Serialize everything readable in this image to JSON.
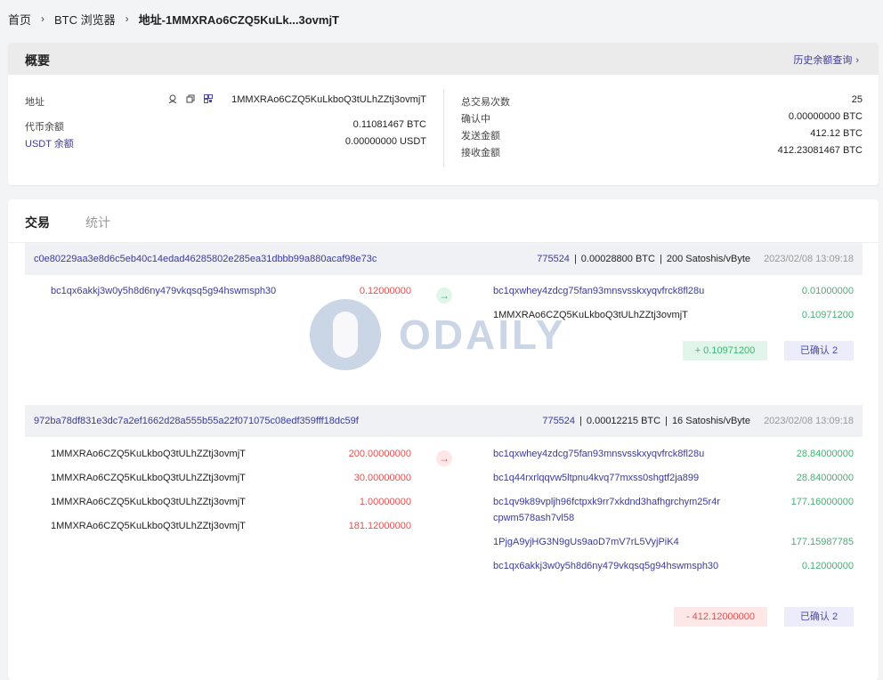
{
  "breadcrumb": {
    "home": "首页",
    "explorer": "BTC 浏览器",
    "current": "地址-1MMXRAo6CZQ5KuLk...3ovmjT"
  },
  "overview": {
    "title": "概要",
    "history_link": "历史余额查询",
    "address_label": "地址",
    "address_value": "1MMXRAo6CZQ5KuLkboQ3tULhZZtj3ovmjT",
    "token_balance_label": "代币余额",
    "token_balance_value": "0.11081467 BTC",
    "usdt_balance_label": "USDT 余额",
    "usdt_balance_value": "0.00000000 USDT",
    "total_tx_label": "总交易次数",
    "total_tx_value": "25",
    "confirming_label": "确认中",
    "confirming_value": "0.00000000 BTC",
    "sent_label": "发送金额",
    "sent_value": "412.12 BTC",
    "received_label": "接收金额",
    "received_value": "412.23081467 BTC"
  },
  "tabs": {
    "transactions": "交易",
    "stats": "统计"
  },
  "watermark": "ODAILY",
  "transactions": [
    {
      "hash": "c0e80229aa3e8d6c5eb40c14edad46285802e285ea31dbbb99a880acaf98e73c",
      "block": "775524",
      "fee": "0.00028800 BTC",
      "rate": "200 Satoshis/vByte",
      "time": "2023/02/08 13:09:18",
      "inputs": [
        {
          "address": "bc1qx6akkj3w0y5h8d6ny479vkqsq5g94hswmsph30",
          "amount": "0.12000000"
        }
      ],
      "outputs": [
        {
          "address": "bc1qxwhey4zdcg75fan93mnsvsskxyqvfrck8fl28u",
          "amount": "0.01000000"
        },
        {
          "address": "1MMXRAo6CZQ5KuLkboQ3tULhZZtj3ovmjT",
          "amount": "0.10971200"
        }
      ],
      "net": "+ 0.10971200",
      "status": "已确认 2"
    },
    {
      "hash": "972ba78df831e3dc7a2ef1662d28a555b55a22f071075c08edf359fff18dc59f",
      "block": "775524",
      "fee": "0.00012215 BTC",
      "rate": "16 Satoshis/vByte",
      "time": "2023/02/08 13:09:18",
      "inputs": [
        {
          "address": "1MMXRAo6CZQ5KuLkboQ3tULhZZtj3ovmjT",
          "amount": "200.00000000"
        },
        {
          "address": "1MMXRAo6CZQ5KuLkboQ3tULhZZtj3ovmjT",
          "amount": "30.00000000"
        },
        {
          "address": "1MMXRAo6CZQ5KuLkboQ3tULhZZtj3ovmjT",
          "amount": "1.00000000"
        },
        {
          "address": "1MMXRAo6CZQ5KuLkboQ3tULhZZtj3ovmjT",
          "amount": "181.12000000"
        }
      ],
      "outputs": [
        {
          "address": "bc1qxwhey4zdcg75fan93mnsvsskxyqvfrck8fl28u",
          "amount": "28.84000000"
        },
        {
          "address": "bc1q44rxrlqqvw5ltpnu4kvq77mxss0shgtf2ja899",
          "amount": "28.84000000"
        },
        {
          "address": "bc1qv9k89vpljh96fctpxk9rr7xkdnd3hafhgrchym25r4rcpwm578ash7vl58",
          "amount": "177.16000000"
        },
        {
          "address": "1PjgA9yjHG3N9gUs9aoD7mV7rL5VyjPiK4",
          "amount": "177.15987785"
        },
        {
          "address": "bc1qx6akkj3w0y5h8d6ny479vkqsq5g94hswmsph30",
          "amount": "0.12000000"
        }
      ],
      "net": "- 412.12000000",
      "status": "已确认 2"
    }
  ],
  "colors": {
    "link": "#3a3a9a",
    "positive": "#3fb472",
    "negative": "#e05353"
  }
}
